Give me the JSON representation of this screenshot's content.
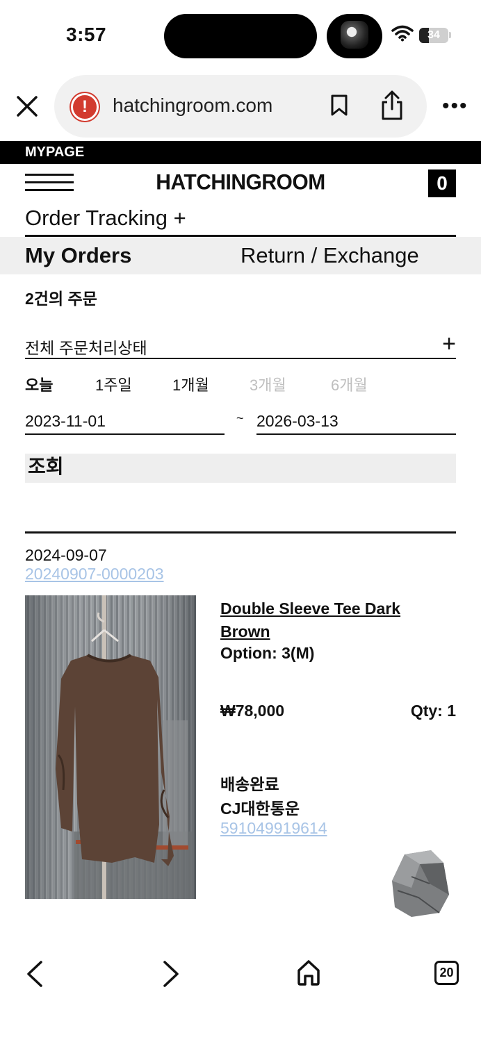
{
  "status_bar": {
    "time": "3:57",
    "battery": "34",
    "battery_level": 0.34
  },
  "browser": {
    "url": "hatchingroom.com"
  },
  "site": {
    "section_label": "MYPAGE",
    "logo": "HATCHINGROOM",
    "cart_count": "0",
    "order_tracking": "Order Tracking +",
    "tabs": {
      "my_orders": "My Orders",
      "return_exchange": "Return / Exchange"
    },
    "order_count": "2건의 주문",
    "status_filter": "전체 주문처리상태",
    "status_filter_toggle": "+",
    "periods": [
      "오늘",
      "1주일",
      "1개월",
      "3개월",
      "6개월"
    ],
    "date_from": "2023-11-01",
    "date_separator": "~",
    "date_to": "2026-03-13",
    "search_label": "조회"
  },
  "order": {
    "date": "2024-09-07",
    "number": "20240907-0000203",
    "product_name": "Double Sleeve Tee Dark Brown",
    "option": "Option: 3(M)",
    "price": "₩78,000",
    "qty": "Qty: 1",
    "ship_status": "배송완료",
    "courier": "CJ대한통운",
    "tracking_number": "591049919614"
  },
  "toolbar": {
    "tab_count": "20"
  },
  "colors": {
    "link": "#a8c4e6",
    "warning": "#d23b2f",
    "product": "#5c4336"
  }
}
